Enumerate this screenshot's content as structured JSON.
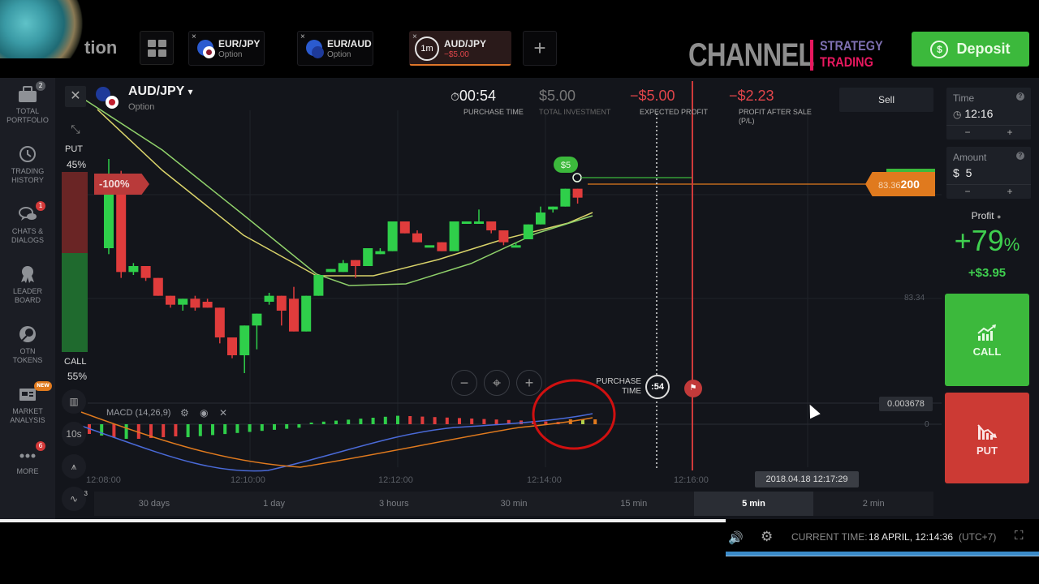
{
  "topbar": {
    "logo_text": "tion",
    "tabs": [
      {
        "name": "EUR/JPY",
        "sub": "Option"
      },
      {
        "name": "EUR/AUD",
        "sub": "Option"
      },
      {
        "name": "AUD/JPY",
        "sub": "−$5.00",
        "timer": "1m",
        "active": true
      }
    ],
    "close_glyph": "×",
    "add_glyph": "+",
    "channel": "CHANNEL",
    "strategy": "STRATEGY",
    "trading": "TRADING",
    "deposit_label": "Deposit",
    "deposit_icon": "$"
  },
  "sidebar": {
    "items": [
      {
        "label1": "TOTAL",
        "label2": "PORTFOLIO",
        "icon": "briefcase-icon",
        "glyph": "💼",
        "badge": "2"
      },
      {
        "label1": "TRADING",
        "label2": "HISTORY",
        "icon": "history-icon",
        "glyph": "↺",
        "badge": ""
      },
      {
        "label1": "CHATS &",
        "label2": "DIALOGS",
        "icon": "chat-icon",
        "glyph": "💬",
        "badge": "1"
      },
      {
        "label1": "LEADER",
        "label2": "BOARD",
        "icon": "medal-icon",
        "glyph": "🏅",
        "badge": ""
      },
      {
        "label1": "OTN",
        "label2": "TOKENS",
        "icon": "token-icon",
        "glyph": "◉",
        "badge": ""
      },
      {
        "label1": "MARKET",
        "label2": "ANALYSIS",
        "icon": "news-icon",
        "glyph": "📰",
        "badge": "NEW"
      },
      {
        "label1": "MORE",
        "label2": "",
        "icon": "more-icon",
        "glyph": "•••",
        "badge": "6"
      }
    ]
  },
  "chart_header": {
    "pair": "AUD/JPY",
    "pair_arrow": "▾",
    "pair_sub": "Option",
    "purchase_time": "00:54",
    "purchase_time_label": "PURCHASE TIME",
    "total_investment": "$5.00",
    "total_investment_label": "TOTAL INVESTMENT",
    "expected_profit": "−$5.00",
    "expected_profit_label": "EXPECTED PROFIT",
    "profit_after_sale": "−$2.23",
    "profit_after_sale_label1": "PROFIT AFTER SALE",
    "profit_after_sale_label2": "(P/L)",
    "sell_label": "Sell"
  },
  "sentiment": {
    "put_label": "PUT",
    "put_pct": "45%",
    "put_value": 45,
    "call_label": "CALL",
    "call_pct": "55%",
    "call_value": 55
  },
  "chart": {
    "loss_tag": "-100%",
    "bet_bubble": "$5",
    "current_price_prefix": "83.36",
    "current_price_suffix": "200",
    "price_axis_label": "83.34",
    "purchase_label1": "PURCHASE",
    "purchase_label2": "TIME",
    "purchase_countdown": ":54",
    "macd_label": "MACD (14,26,9)",
    "macd_value": "0.003678",
    "macd_zero": "0",
    "x_ticks": [
      "12:08:00",
      "12:10:00",
      "12:12:00",
      "12:14:00",
      "12:16:00"
    ],
    "cursor_date": "2018.04.18 12:17:29",
    "zoom_out": "−",
    "zoom_center": "⌖",
    "zoom_in": "+",
    "tool_interval": "10s",
    "tool_badge": "3",
    "candles": [
      [
        0,
        83.3,
        83.55,
        83.6,
        83.28
      ],
      [
        1,
        83.55,
        83.22,
        83.56,
        83.2
      ],
      [
        2,
        83.22,
        83.24,
        83.25,
        83.21
      ],
      [
        3,
        83.24,
        83.2,
        83.24,
        83.19
      ],
      [
        4,
        83.2,
        83.14,
        83.2,
        83.14
      ],
      [
        5,
        83.14,
        83.11,
        83.14,
        83.1
      ],
      [
        6,
        83.11,
        83.13,
        83.13,
        83.09
      ],
      [
        7,
        83.13,
        83.1,
        83.14,
        83.09
      ],
      [
        8,
        83.12,
        83.1,
        83.13,
        83.1
      ],
      [
        9,
        83.1,
        83.0,
        83.1,
        82.98
      ],
      [
        10,
        83.0,
        82.94,
        83.0,
        82.93
      ],
      [
        11,
        82.94,
        83.04,
        83.04,
        82.88
      ],
      [
        12,
        83.04,
        83.08,
        83.08,
        82.96
      ],
      [
        13,
        83.12,
        83.14,
        83.15,
        83.11
      ],
      [
        14,
        83.14,
        83.09,
        83.14,
        83.04
      ],
      [
        15,
        83.13,
        83.02,
        83.17,
        83.02
      ],
      [
        16,
        83.02,
        83.14,
        83.14,
        83.02
      ],
      [
        17,
        83.14,
        83.21,
        83.21,
        83.14
      ],
      [
        18,
        83.22,
        83.23,
        83.23,
        83.22
      ],
      [
        19,
        83.22,
        83.25,
        83.26,
        83.22
      ],
      [
        20,
        83.26,
        83.24,
        83.26,
        83.2
      ],
      [
        21,
        83.24,
        83.3,
        83.3,
        83.24
      ],
      [
        22,
        83.28,
        83.29,
        83.3,
        83.28
      ],
      [
        23,
        83.29,
        83.39,
        83.39,
        83.29
      ],
      [
        24,
        83.39,
        83.35,
        83.39,
        83.35
      ],
      [
        25,
        83.35,
        83.32,
        83.36,
        83.32
      ],
      [
        26,
        83.31,
        83.31,
        83.31,
        83.31
      ],
      [
        27,
        83.32,
        83.29,
        83.32,
        83.29
      ],
      [
        28,
        83.29,
        83.39,
        83.39,
        83.29
      ],
      [
        29,
        83.39,
        83.39,
        83.39,
        83.39
      ],
      [
        30,
        83.39,
        83.39,
        83.43,
        83.39
      ],
      [
        31,
        83.39,
        83.36,
        83.39,
        83.35
      ],
      [
        32,
        83.36,
        83.32,
        83.36,
        83.31
      ],
      [
        33,
        83.31,
        83.31,
        83.32,
        83.31
      ],
      [
        34,
        83.33,
        83.38,
        83.38,
        83.33
      ],
      [
        35,
        83.38,
        83.42,
        83.44,
        83.38
      ],
      [
        36,
        83.43,
        83.44,
        83.44,
        83.42
      ],
      [
        37,
        83.44,
        83.5,
        83.5,
        83.44
      ],
      [
        38,
        83.5,
        83.47,
        83.5,
        83.45
      ]
    ]
  },
  "periods": [
    "30 days",
    "1 day",
    "3 hours",
    "30 min",
    "15 min",
    "5 min",
    "2 min"
  ],
  "active_period": "5 min",
  "right_panel": {
    "time_label": "Time",
    "time_value": "12:16",
    "amount_label": "Amount",
    "amount_currency": "$",
    "amount_value": "5",
    "help": "?",
    "minus": "−",
    "plus": "+",
    "profit_label": "Profit",
    "profit_pct": "+79",
    "profit_pct_sign": "%",
    "profit_amount": "+$3.95",
    "call_label": "CALL",
    "put_label": "PUT"
  },
  "bottom": {
    "current_time_label": "CURRENT TIME:",
    "current_time_value": "18 APRIL, 12:14:36",
    "timezone": "(UTC+7)"
  },
  "colors": {
    "green": "#3cb93c",
    "red": "#cc3a34",
    "orange": "#e07a1e",
    "brand_pink": "#e8185f"
  }
}
